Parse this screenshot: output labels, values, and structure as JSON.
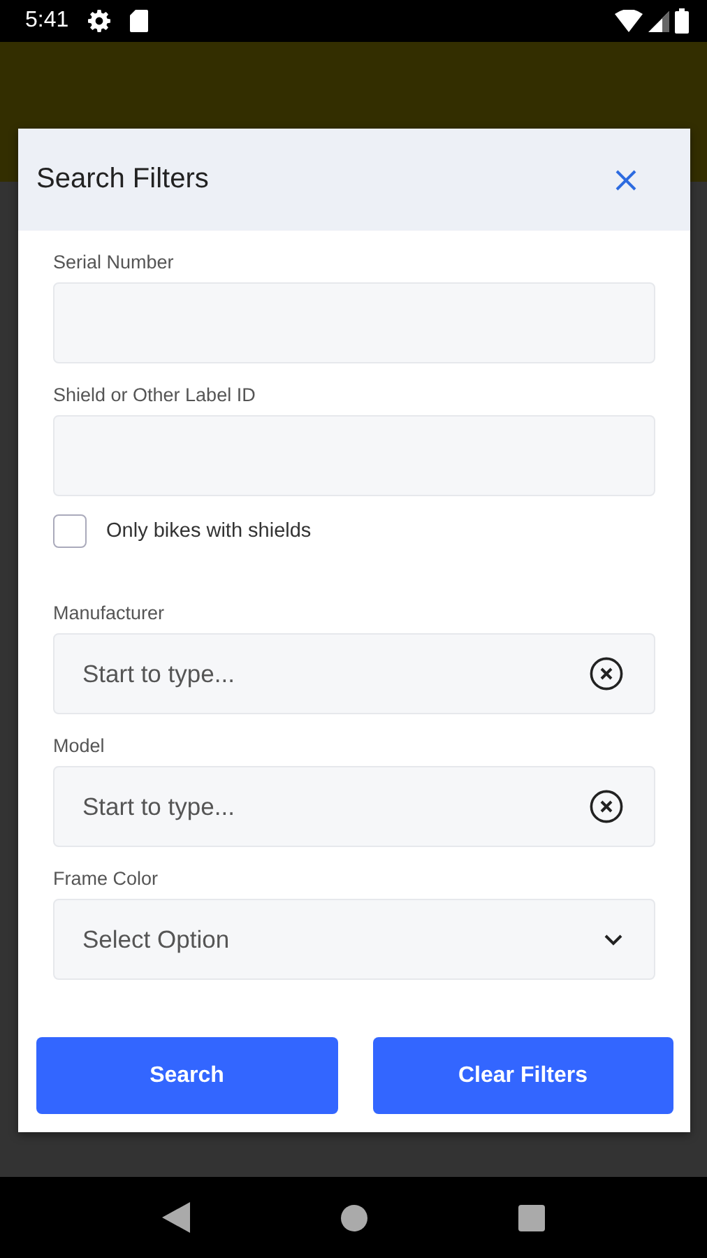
{
  "status_bar": {
    "time": "5:41"
  },
  "dialog": {
    "title": "Search Filters",
    "fields": [
      {
        "kind": "text",
        "label": "Serial Number"
      },
      {
        "kind": "text",
        "label": "Shield or Other Label ID"
      },
      {
        "kind": "checkbox",
        "label": "Only bikes with shields",
        "checked": false
      },
      {
        "kind": "autocomplete",
        "label": "Manufacturer",
        "placeholder": "Start to type..."
      },
      {
        "kind": "autocomplete",
        "label": "Model",
        "placeholder": "Start to type..."
      },
      {
        "kind": "select",
        "label": "Frame Color",
        "value": "Select Option"
      }
    ],
    "buttons": [
      {
        "label": "Search"
      },
      {
        "label": "Clear Filters"
      }
    ]
  }
}
